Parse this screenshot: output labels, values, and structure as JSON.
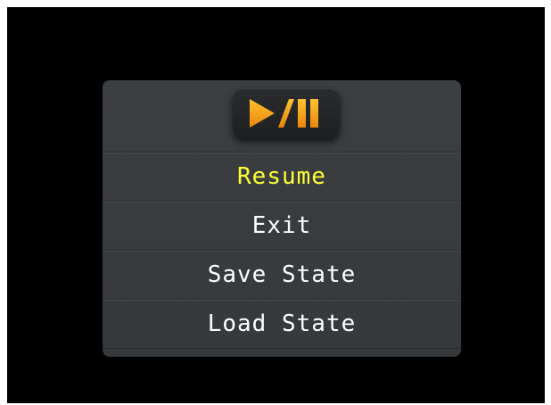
{
  "menu": {
    "header_icon": "play-pause-icon",
    "items": [
      {
        "label": "Resume",
        "selected": true
      },
      {
        "label": "Exit",
        "selected": false
      },
      {
        "label": "Save State",
        "selected": false
      },
      {
        "label": "Load State",
        "selected": false
      }
    ]
  },
  "colors": {
    "background": "#000000",
    "panel": "#3a3d40",
    "selected_text": "#ffff33",
    "text": "#ffffff",
    "icon_orange": "#f5a623"
  }
}
